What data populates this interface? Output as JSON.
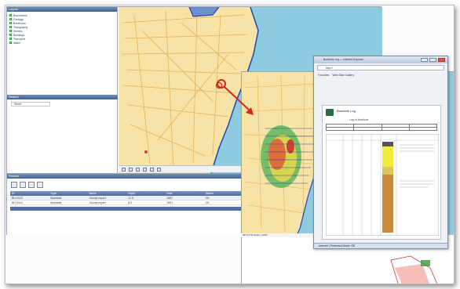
{
  "main_window": {
    "layers_panel_title": "Layers",
    "layers": [
      "Boundaries",
      "Geology",
      "Boreholes",
      "Topography",
      "Streets",
      "Buildings",
      "Transport",
      "Water"
    ],
    "lower_panel_title": "Search",
    "lower_field_value": "Street",
    "table_panel_title": "Results",
    "table_columns": [
      "ID",
      "Type",
      "Name",
      "Depth",
      "Date",
      "Status"
    ],
    "table_rows": [
      [
        "BH-0123",
        "Borehole",
        "Survey report",
        "12.5",
        "1987",
        "OK"
      ],
      [
        "BH-0124",
        "Borehole",
        "Survey report",
        "8.0",
        "1991",
        "OK"
      ]
    ]
  },
  "map2": {
    "status_text": "39°N 9°W  Scale 1:2000"
  },
  "log_window": {
    "title": "Borehole log — Internet Explorer",
    "address": "http://",
    "toolbar_items": [
      "Favorites",
      "Web Slice Gallery"
    ],
    "doc_title": "Borehole Log",
    "doc_subtitle": "Log of borehole",
    "status_text": "Internet | Protected Mode: Off"
  },
  "colors": {
    "sea": "#8fcbe0",
    "land": "#f7e3a6",
    "street": "#e2b25a",
    "boundary": "#2345b0",
    "pointer": "#d8241b"
  }
}
